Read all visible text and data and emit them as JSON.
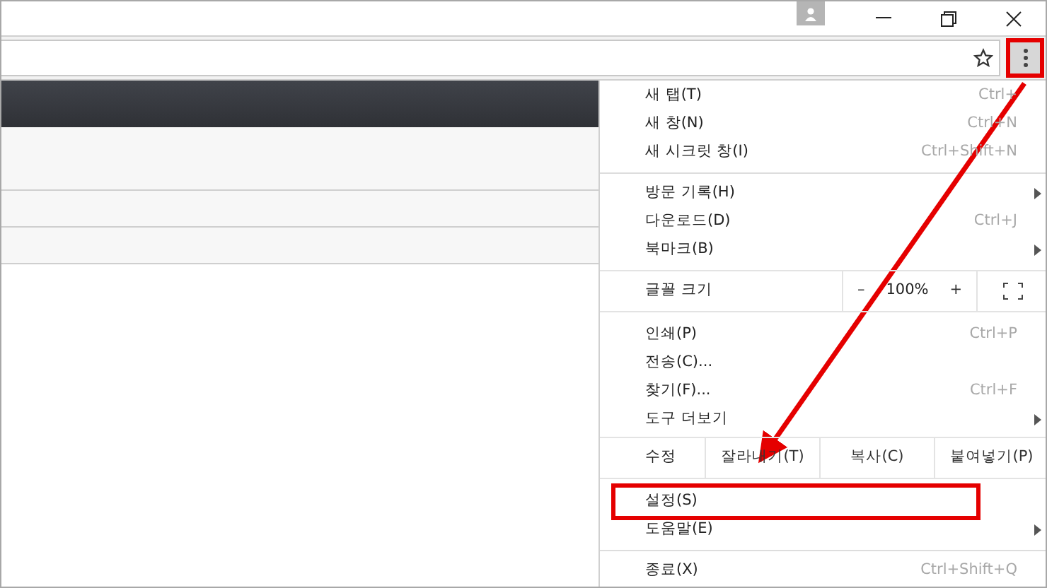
{
  "toolbar": {
    "menu_button": {
      "highlighted": true
    }
  },
  "menu": {
    "items": [
      {
        "kind": "item",
        "label": "새 탭(T)",
        "shortcut": "Ctrl+",
        "submenu": false,
        "highlighted": false
      },
      {
        "kind": "item",
        "label": "새 창(N)",
        "shortcut": "Ctrl+N",
        "submenu": false,
        "highlighted": false
      },
      {
        "kind": "item",
        "label": "새 시크릿 창(I)",
        "shortcut": "Ctrl+Shift+N",
        "submenu": false,
        "highlighted": false
      },
      {
        "kind": "separator"
      },
      {
        "kind": "item",
        "label": "방문 기록(H)",
        "submenu": true,
        "highlighted": false
      },
      {
        "kind": "item",
        "label": "다운로드(D)",
        "shortcut": "Ctrl+J",
        "submenu": false,
        "highlighted": false
      },
      {
        "kind": "item",
        "label": "북마크(B)",
        "submenu": true,
        "highlighted": false
      },
      {
        "kind": "zoom",
        "label": "글꼴 크기",
        "minus": "–",
        "value": "100%",
        "plus": "+"
      },
      {
        "kind": "item",
        "label": "인쇄(P)",
        "shortcut": "Ctrl+P",
        "submenu": false,
        "highlighted": false
      },
      {
        "kind": "item",
        "label": "전송(C)...",
        "submenu": false,
        "highlighted": false
      },
      {
        "kind": "item",
        "label": "찾기(F)...",
        "shortcut": "Ctrl+F",
        "submenu": false,
        "highlighted": false
      },
      {
        "kind": "item",
        "label": "도구 더보기",
        "submenu": true,
        "highlighted": false
      },
      {
        "kind": "edit",
        "label": "수정",
        "buttons": [
          "잘라내기(T)",
          "복사(C)",
          "붙여넣기(P)"
        ]
      },
      {
        "kind": "item",
        "label": "설정(S)",
        "submenu": false,
        "highlighted": true
      },
      {
        "kind": "item",
        "label": "도움말(E)",
        "submenu": true,
        "highlighted": false
      },
      {
        "kind": "separator"
      },
      {
        "kind": "item",
        "label": "종료(X)",
        "shortcut": "Ctrl+Shift+Q",
        "submenu": false,
        "highlighted": false
      }
    ]
  }
}
